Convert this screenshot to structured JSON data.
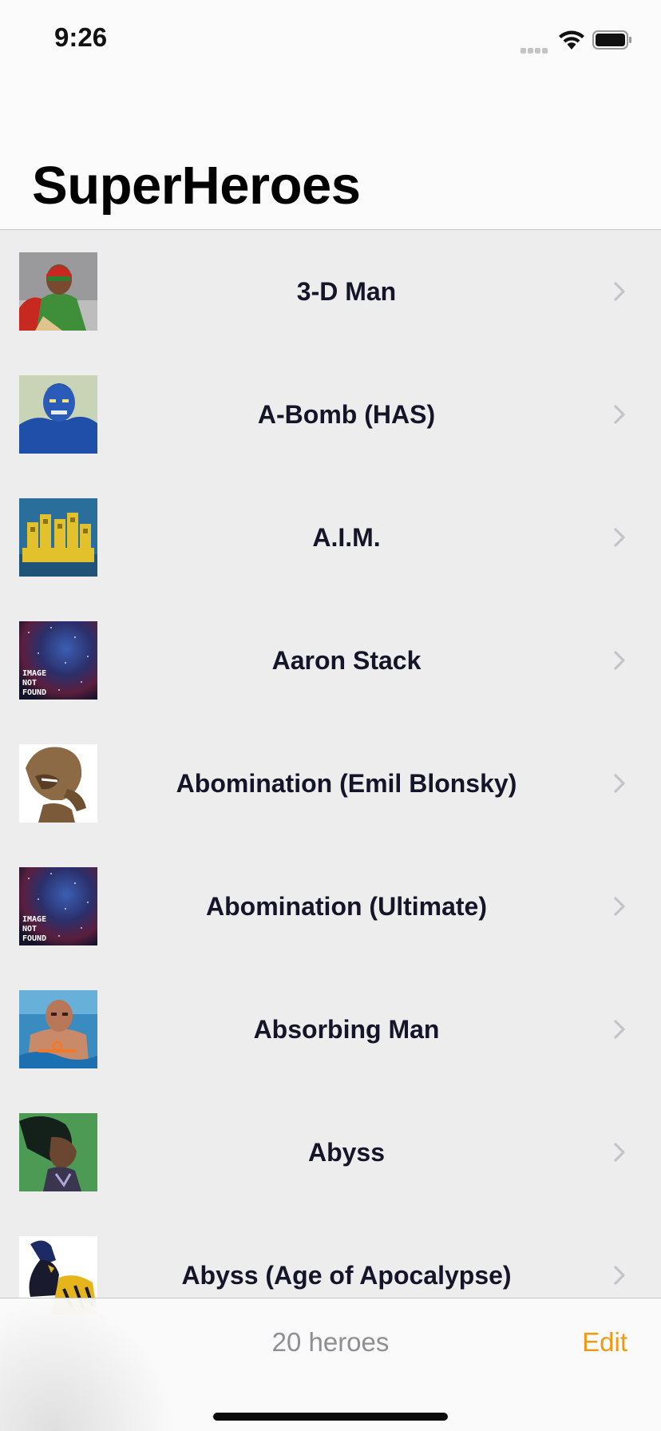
{
  "status_bar": {
    "time": "9:26",
    "signal_icon": "signal-icon",
    "wifi_icon": "wifi-icon",
    "battery_icon": "battery-icon"
  },
  "nav": {
    "title": "SuperHeroes"
  },
  "heroes": [
    {
      "name": "3-D Man",
      "thumbnail": "hero-portrait"
    },
    {
      "name": "A-Bomb (HAS)",
      "thumbnail": "hero-portrait"
    },
    {
      "name": "A.I.M.",
      "thumbnail": "hero-portrait"
    },
    {
      "name": "Aaron Stack",
      "thumbnail": "image-not-found"
    },
    {
      "name": "Abomination (Emil Blonsky)",
      "thumbnail": "hero-portrait"
    },
    {
      "name": "Abomination (Ultimate)",
      "thumbnail": "image-not-found"
    },
    {
      "name": "Absorbing Man",
      "thumbnail": "hero-portrait"
    },
    {
      "name": "Abyss",
      "thumbnail": "hero-portrait"
    },
    {
      "name": "Abyss (Age of Apocalypse)",
      "thumbnail": "hero-portrait"
    }
  ],
  "toolbar": {
    "count_label": "20 heroes",
    "edit_label": "Edit"
  },
  "colors": {
    "accent": "#f09a13",
    "list_background": "#ededee",
    "bar_background": "#fbfbfb",
    "chevron": "#c4c4c7"
  }
}
